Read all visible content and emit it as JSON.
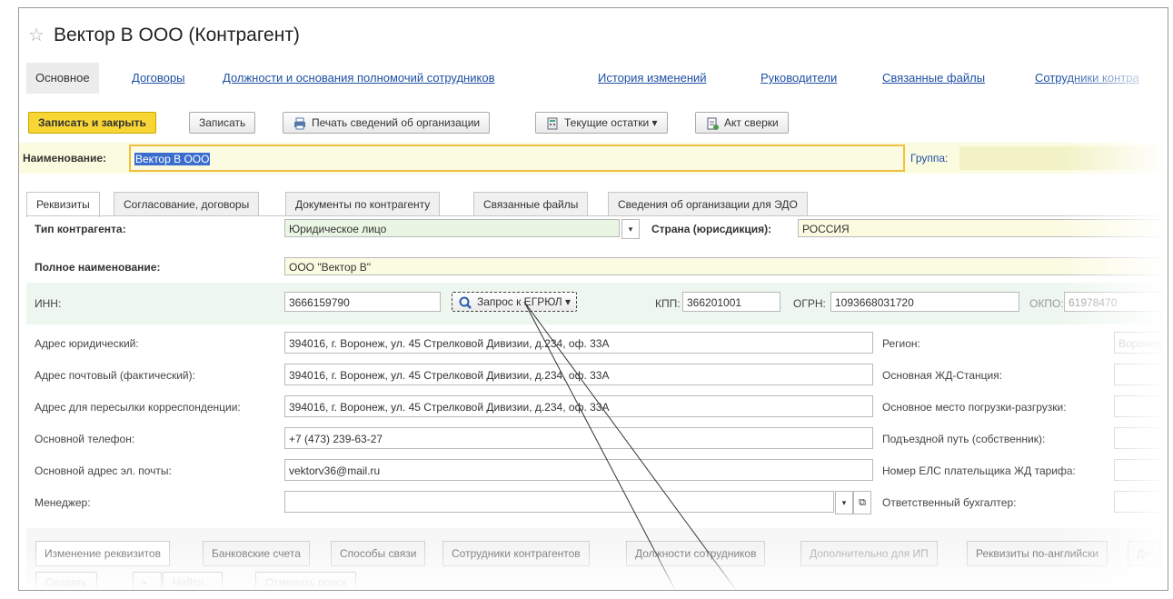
{
  "window": {
    "title": "Вектор В ООО (Контрагент)"
  },
  "nav_tabs": [
    "Основное",
    "Договоры",
    "Должности и основания полномочий сотрудников",
    "История изменений",
    "Руководители",
    "Связанные файлы",
    "Сотрудники контра"
  ],
  "toolbar": {
    "save_close": "Записать и закрыть",
    "save": "Записать",
    "print": "Печать сведений об организации",
    "balances": "Текущие остатки",
    "reconcile": "Акт сверки"
  },
  "name_row": {
    "label": "Наименование:",
    "value": "Вектор В ООО",
    "group_label": "Группа:"
  },
  "tabs": [
    "Реквизиты",
    "Согласование, договоры",
    "Документы по контрагенту",
    "Связанные файлы",
    "Сведения об организации для ЭДО"
  ],
  "form": {
    "type_label": "Тип контрагента:",
    "type_value": "Юридическое лицо",
    "country_label": "Страна (юрисдикция):",
    "country_value": "РОССИЯ",
    "full_name_label": "Полное наименование:",
    "full_name_value": "ООО \"Вектор В\"",
    "inn_label": "ИНН:",
    "inn_value": "3666159790",
    "egrul_button": "Запрос к ЕГРЮЛ",
    "kpp_label": "КПП:",
    "kpp_value": "366201001",
    "ogrn_label": "ОГРН:",
    "ogrn_value": "1093668031720",
    "okpo_label": "ОКПО:",
    "okpo_value": "61978470",
    "legal_addr_label": "Адрес юридический:",
    "legal_addr_value": "394016, г. Воронеж, ул. 45 Стрелковой Дивизии, д.234, оф. 33А",
    "postal_addr_label": "Адрес почтовый (фактический):",
    "postal_addr_value": "394016, г. Воронеж, ул. 45 Стрелковой Дивизии, д.234, оф. 33А",
    "mail_addr_label": "Адрес для пересылки корреспонденции:",
    "mail_addr_value": "394016, г. Воронеж, ул. 45 Стрелковой Дивизии, д.234, оф. 33А",
    "phone_label": "Основной телефон:",
    "phone_value": "+7 (473) 239-63-27",
    "email_label": "Основной адрес эл. почты:",
    "email_value": "vektorv36@mail.ru",
    "manager_label": "Менеджер:",
    "region_label": "Регион:",
    "region_value": "Воронеж",
    "station_label": "Основная ЖД-Станция:",
    "loading_label": "Основное место погрузки-разгрузки:",
    "track_label": "Подъездной путь (собственник):",
    "els_label": "Номер ЕЛС плательщика ЖД тарифа:",
    "accountant_label": "Ответственный бухгалтер:"
  },
  "subtabs": [
    "Изменение реквизитов",
    "Банковские счета",
    "Способы связи",
    "Сотрудники контрагентов",
    "Должности сотрудников",
    "Дополнительно для ИП",
    "Реквизиты по-английски",
    "До"
  ],
  "subtoolbar": {
    "create": "Создать",
    "find": "Найти...",
    "cancel_search": "Отменить поиск"
  },
  "colors": {
    "primary_button": "#f7d535",
    "link": "#1e4fa3",
    "input_green": "#eaf6e4",
    "input_yellow": "#fbfbe2"
  }
}
